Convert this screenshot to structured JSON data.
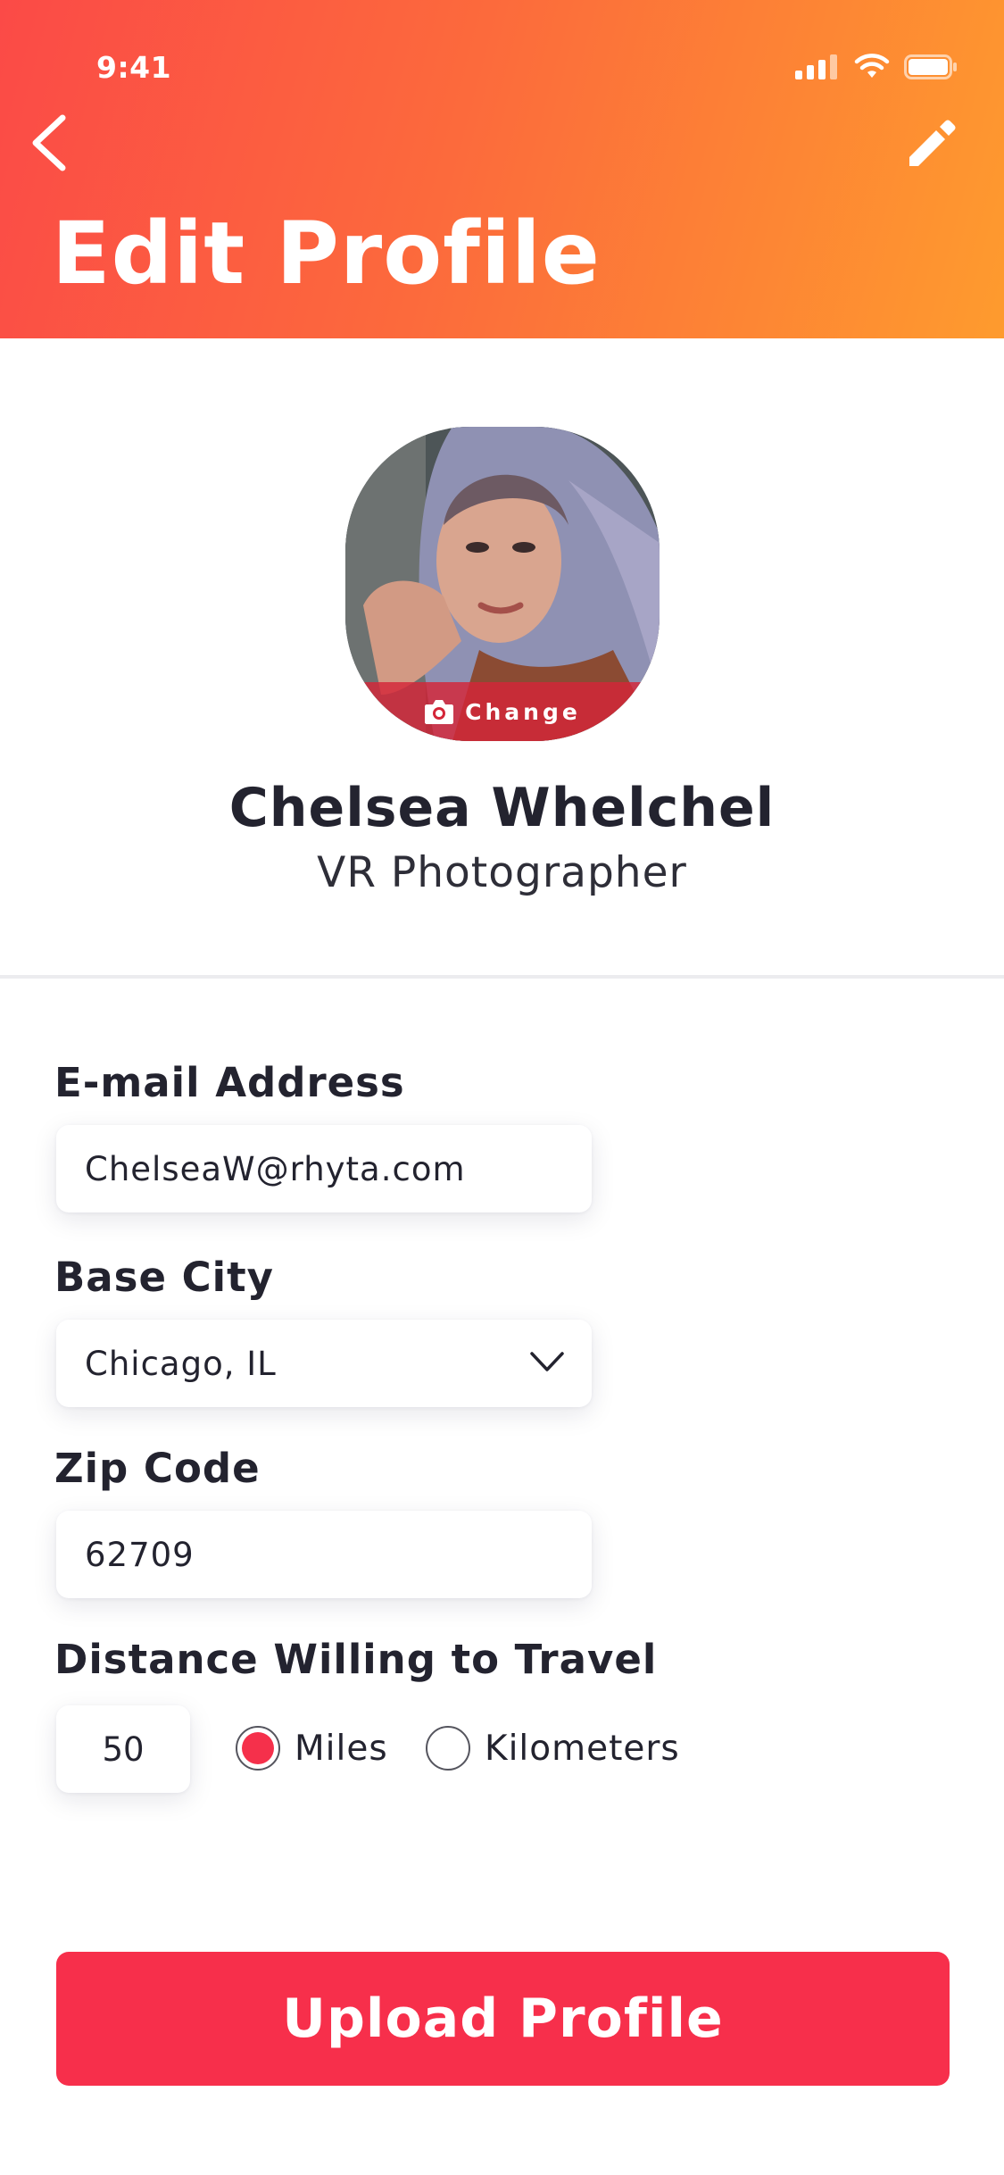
{
  "status_bar": {
    "time": "9:41"
  },
  "header": {
    "title": "Edit Profile",
    "back_icon": "chevron-left-icon",
    "edit_icon": "pencil-icon",
    "gradient": [
      "#fb4a47",
      "#fe9b2e"
    ]
  },
  "profile": {
    "change_label": "Change",
    "name": "Chelsea Whelchel",
    "role": "VR Photographer"
  },
  "form": {
    "email": {
      "label": "E-mail Address",
      "value": "ChelseaW@rhyta.com"
    },
    "city": {
      "label": "Base City",
      "value": "Chicago, IL"
    },
    "zip": {
      "label": "Zip Code",
      "value": "62709"
    },
    "distance": {
      "label": "Distance Willing to Travel",
      "value": "50",
      "units": [
        {
          "label": "Miles",
          "selected": true
        },
        {
          "label": "Kilometers",
          "selected": false
        }
      ]
    }
  },
  "actions": {
    "upload_label": "Upload Profile"
  },
  "colors": {
    "accent": "#f72f4b",
    "text": "#23232f"
  }
}
